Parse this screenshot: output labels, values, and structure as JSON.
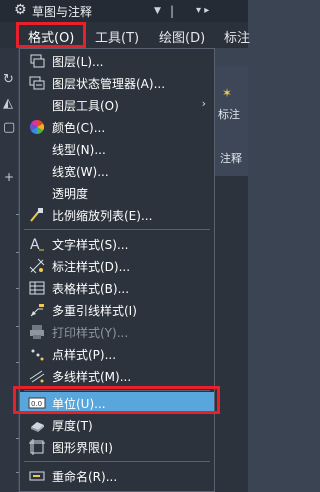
{
  "titlebar": {
    "title": "草图与注释",
    "more": "▾ ▸"
  },
  "menubar": {
    "items": [
      "格式(O)",
      "工具(T)",
      "绘图(D)",
      "标注"
    ]
  },
  "ribbon": {
    "right_label_1": "标注",
    "right_label_2": "注释"
  },
  "menu": {
    "items": [
      {
        "label": "图层(L)...",
        "icon": "layers-icon"
      },
      {
        "label": "图层状态管理器(A)...",
        "icon": "layer-state-manager-icon"
      },
      {
        "label": "图层工具(O)",
        "icon": "",
        "submenu": "›"
      },
      {
        "label": "颜色(C)...",
        "icon": "color-wheel-icon"
      },
      {
        "label": "线型(N)...",
        "icon": ""
      },
      {
        "label": "线宽(W)...",
        "icon": ""
      },
      {
        "label": "透明度",
        "icon": ""
      },
      {
        "label": "比例缩放列表(E)...",
        "icon": "scale-list-icon"
      },
      {
        "label": "文字样式(S)...",
        "icon": "text-style-icon"
      },
      {
        "label": "标注样式(D)...",
        "icon": "dimension-style-icon"
      },
      {
        "label": "表格样式(B)...",
        "icon": "table-style-icon"
      },
      {
        "label": "多重引线样式(I)",
        "icon": "multileader-style-icon"
      },
      {
        "label": "打印样式(Y)...",
        "icon": "plot-style-icon",
        "disabled": true
      },
      {
        "label": "点样式(P)...",
        "icon": "point-style-icon"
      },
      {
        "label": "多线样式(M)...",
        "icon": "multiline-style-icon"
      },
      {
        "label": "单位(U)...",
        "icon": "units-icon",
        "selected": true
      },
      {
        "label": "厚度(T)",
        "icon": "thickness-icon"
      },
      {
        "label": "图形界限(I)",
        "icon": "drawing-limits-icon"
      },
      {
        "label": "重命名(R)...",
        "icon": "rename-icon"
      }
    ]
  },
  "colors": {
    "highlight_box": "#e8202a",
    "selected_item": "#58a6dc",
    "menu_bg": "#2c333d"
  }
}
